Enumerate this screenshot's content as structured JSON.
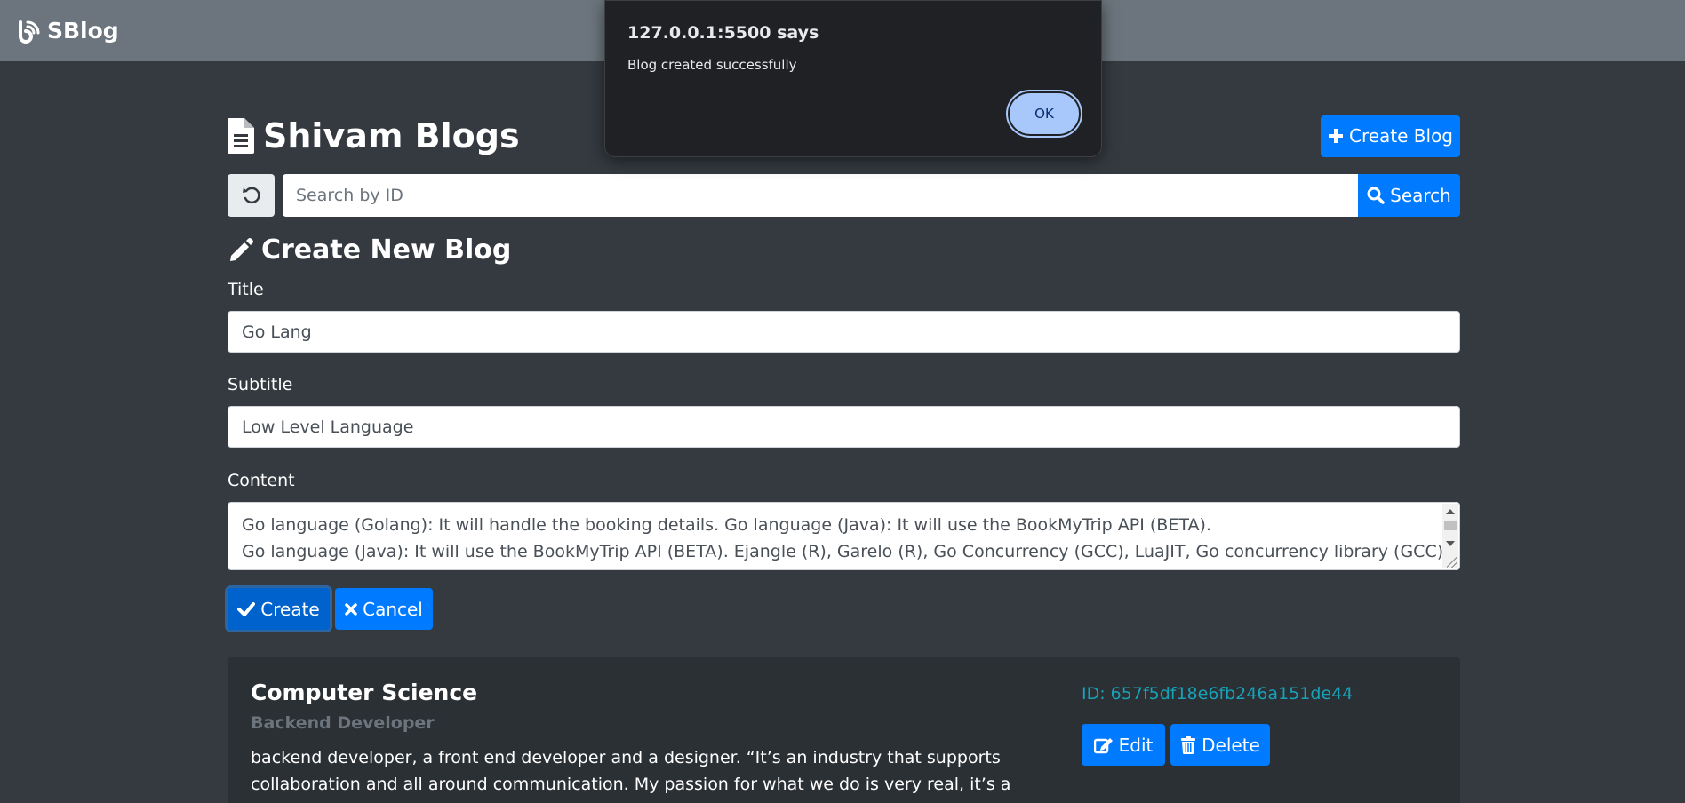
{
  "navbar": {
    "brand": "SBlog",
    "brand_icon": "blog-icon"
  },
  "page": {
    "title": "Shivam Blogs",
    "title_icon": "document-icon",
    "create_blog_label": "Create Blog"
  },
  "search": {
    "placeholder": "Search by ID",
    "value": "",
    "button_label": "Search"
  },
  "form": {
    "heading": "Create New Blog",
    "title_label": "Title",
    "title_value": "Go Lang",
    "subtitle_label": "Subtitle",
    "subtitle_value": "Low Level Language",
    "content_label": "Content",
    "content_line1": "Go language (Golang): It will handle the booking details. Go language (Java): It will use the BookMyTrip API (BETA).",
    "content_line2": "Go language (Java): It will use the BookMyTrip API (BETA). Ejangle (R), Garelo (R), Go Concurrency (GCC), LuaJIT, Go concurrency library (GCC), Java",
    "create_label": "Create",
    "cancel_label": "Cancel"
  },
  "blogs": [
    {
      "title": "Computer Science",
      "subtitle": "Backend Developer",
      "content": "backend developer, a front end developer and a designer. “It’s an industry that supports collaboration and all around communication. My passion for what we do is very real, it’s a hard job,",
      "id_text": "ID: 657f5df18e6fb246a151de44",
      "edit_label": "Edit",
      "delete_label": "Delete"
    }
  ],
  "dialog": {
    "origin": "127.0.0.1:5500 says",
    "message": "Blog created successfully",
    "ok_label": "OK"
  },
  "colors": {
    "primary": "#007bff",
    "navbar": "#6c757d",
    "background": "#343a40",
    "card": "#2b3035",
    "id_text": "#17a2b8",
    "dialog_button": "#a8c7fa"
  }
}
